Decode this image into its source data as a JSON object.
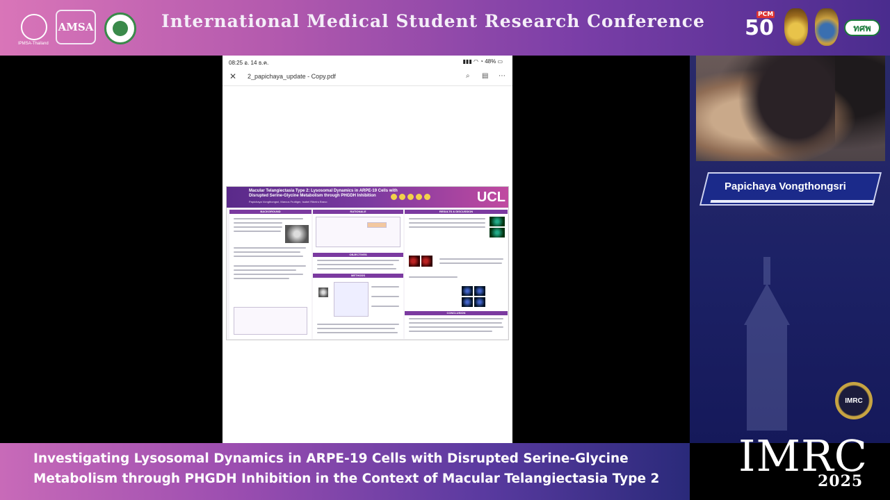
{
  "header": {
    "title": "International Medical Student Research Conference",
    "logos": {
      "ipmsa_label": "IPMSA-Thailand",
      "amsa": "AMSA",
      "pcm_fifty": "50",
      "pcm_label": "PCM",
      "ttmk": "ทศพ"
    }
  },
  "shared_screen": {
    "status_time": "08:25  อ. 14 ธ.ค.",
    "status_right": "▮▮▮ ◠ ◔ 48% ▭",
    "file_name": "2_papichaya_update - Copy.pdf",
    "poster": {
      "title": "Macular Telangiectasia Type 2: Lysosomal Dynamics in ARPE-19 Cells with Disrupted Serine-Glycine Metabolism through PHGDH Inhibition",
      "authors": "Papichaya Vongthongsri, Marcus Fruttiger, Isabel Ribeiro Bravo",
      "brand": "UCL",
      "sections": {
        "background": "BACKGROUND",
        "rationale": "RATIONALE",
        "results": "RESULTS & DISCUSSION",
        "objectives": "OBJECTIVES",
        "methods": "METHODS",
        "conclusion": "CONCLUSION"
      }
    }
  },
  "speaker": {
    "name": "Papichaya Vongthongsri"
  },
  "branding": {
    "badge": "IMRC",
    "word": "IMRC",
    "year": "2025"
  },
  "caption": {
    "line1": "Investigating Lysosomal Dynamics in ARPE-19 Cells with Disrupted Serine-Glycine",
    "line2": "Metabolism through PHGDH Inhibition in the Context of Macular Telangiectasia Type 2"
  },
  "colors": {
    "header_start": "#d975b8",
    "header_end": "#4a2c8e",
    "panel": "#1d2266",
    "poster_accent": "#7b3aa0"
  }
}
